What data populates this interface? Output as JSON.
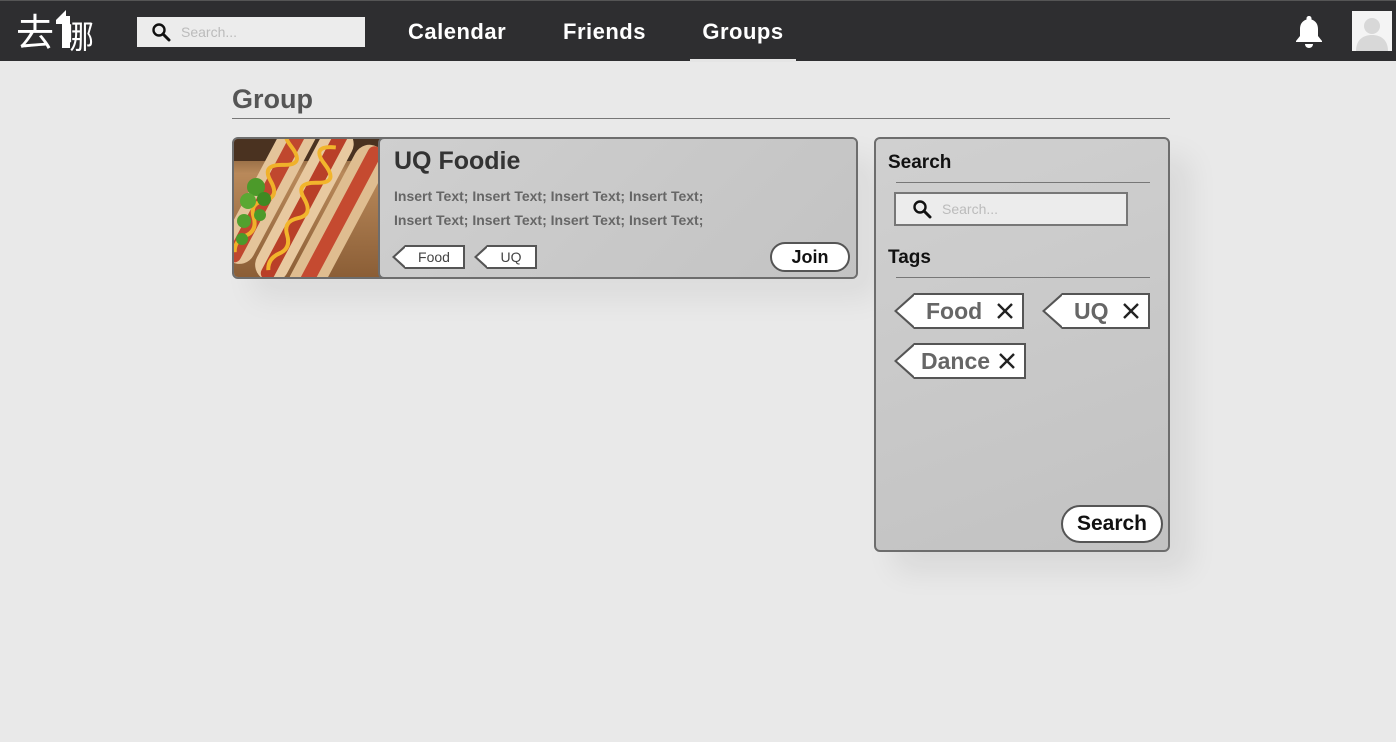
{
  "header": {
    "logo_text": "去哪",
    "search_placeholder": "Search...",
    "nav": {
      "calendar": "Calendar",
      "friends": "Friends",
      "groups": "Groups"
    },
    "active_nav": "Groups"
  },
  "page": {
    "title": "Group"
  },
  "group_card": {
    "name": "UQ Foodie",
    "description_lines": [
      "Insert Text; Insert Text; Insert Text; Insert Text;",
      "Insert Text; Insert Text; Insert Text; Insert Text;"
    ],
    "tags": [
      "Food",
      "UQ"
    ],
    "join_label": "Join"
  },
  "side_panel": {
    "search_heading": "Search",
    "search_placeholder": "Search...",
    "tags_heading": "Tags",
    "tags": [
      "Food",
      "UQ",
      "Dance"
    ],
    "search_button": "Search"
  }
}
